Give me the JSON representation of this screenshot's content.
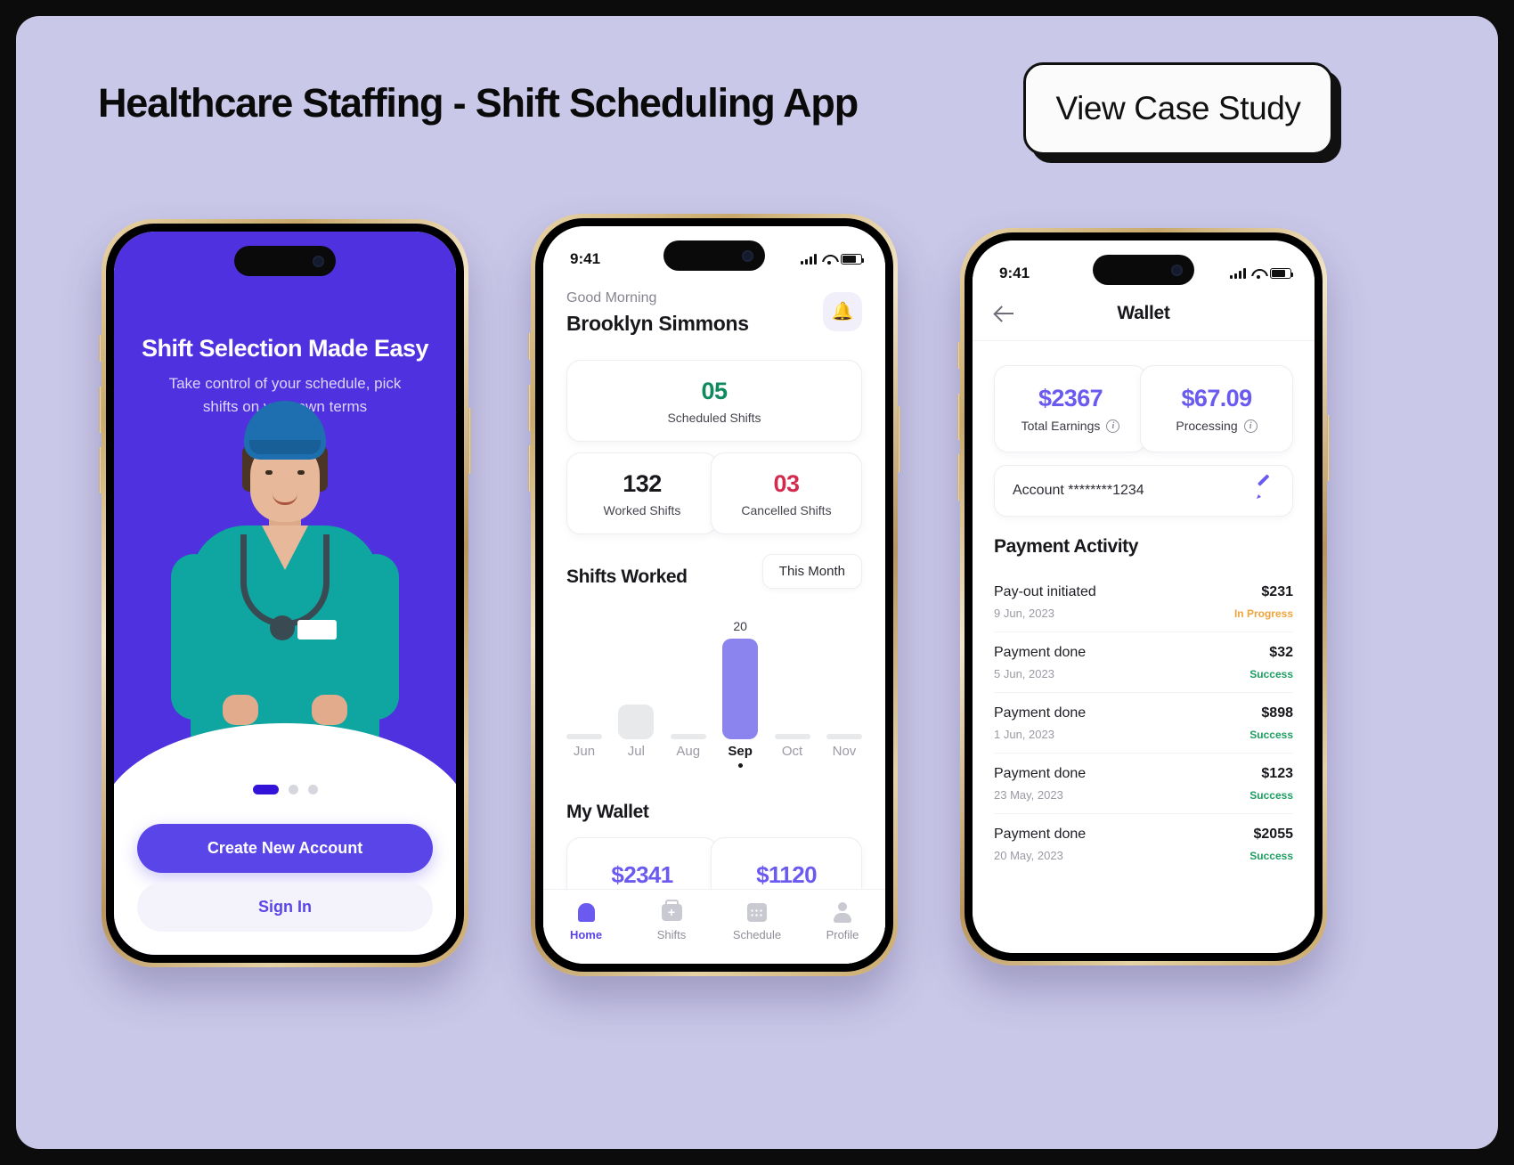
{
  "header": {
    "title": "Healthcare Staffing - Shift Scheduling App",
    "cta_label": "View Case Study"
  },
  "colors": {
    "background": "#cac8e8",
    "brand_purple": "#5a45e8",
    "onboarding_bg": "#4f31e0",
    "accent_light_purple": "#8b84ef",
    "success_green": "#0f8a5f",
    "danger_red": "#d32b4e",
    "warning_orange": "#f0a33c"
  },
  "phone1": {
    "title": "Shift Selection Made Easy",
    "subtitle": "Take control of your schedule, pick shifts on your own terms",
    "pagination": {
      "total": 3,
      "active": 1
    },
    "primary_button": "Create New Account",
    "secondary_button": "Sign In"
  },
  "phone2": {
    "status": {
      "time": "9:41"
    },
    "greeting": "Good Morning",
    "user_name": "Brooklyn Simmons",
    "notification_icon": "bell-icon",
    "stats": [
      {
        "value": "05",
        "label": "Scheduled Shifts",
        "color": "#0f8a5f"
      },
      {
        "value": "132",
        "label": "Worked Shifts",
        "color": "#17171c"
      },
      {
        "value": "03",
        "label": "Cancelled Shifts",
        "color": "#d32b4e"
      }
    ],
    "chart_section_title": "Shifts Worked",
    "period_label": "This Month",
    "wallet_title": "My Wallet",
    "wallet_cards": [
      {
        "amount": "$2341"
      },
      {
        "amount": "$1120"
      }
    ],
    "tabs": [
      {
        "label": "Home",
        "icon": "home-icon",
        "active": true
      },
      {
        "label": "Shifts",
        "icon": "briefcase-plus-icon",
        "active": false
      },
      {
        "label": "Schedule",
        "icon": "calendar-icon",
        "active": false
      },
      {
        "label": "Profile",
        "icon": "user-icon",
        "active": false
      }
    ]
  },
  "chart_data": {
    "type": "bar",
    "title": "Shifts Worked",
    "categories": [
      "Jun",
      "Jul",
      "Aug",
      "Sep",
      "Oct",
      "Nov"
    ],
    "values": [
      1,
      7,
      1,
      20,
      1,
      1
    ],
    "labels": [
      "",
      "",
      "",
      "20",
      "",
      ""
    ],
    "selected_category": "Sep",
    "selected_value": 20,
    "xlabel": "",
    "ylabel": "",
    "ylim": [
      0,
      22
    ],
    "grid": false,
    "legend": false,
    "period": "This Month"
  },
  "phone3": {
    "status": {
      "time": "9:41"
    },
    "back_icon": "back-arrow-icon",
    "title": "Wallet",
    "earnings": [
      {
        "amount": "$2367",
        "label": "Total Earnings",
        "info_icon": "info-icon"
      },
      {
        "amount": "$67.09",
        "label": "Processing",
        "info_icon": "info-icon"
      }
    ],
    "account_label": "Account ********1234",
    "edit_icon": "pencil-icon",
    "activity_title": "Payment Activity",
    "activity": [
      {
        "title": "Pay-out initiated",
        "date": "9 Jun, 2023",
        "amount": "$231",
        "status": "In Progress",
        "status_color": "#f0a33c"
      },
      {
        "title": "Payment done",
        "date": "5 Jun, 2023",
        "amount": "$32",
        "status": "Success",
        "status_color": "#1f9d62"
      },
      {
        "title": "Payment done",
        "date": "1 Jun, 2023",
        "amount": "$898",
        "status": "Success",
        "status_color": "#1f9d62"
      },
      {
        "title": "Payment done",
        "date": "23 May, 2023",
        "amount": "$123",
        "status": "Success",
        "status_color": "#1f9d62"
      },
      {
        "title": "Payment done",
        "date": "20 May, 2023",
        "amount": "$2055",
        "status": "Success",
        "status_color": "#1f9d62"
      }
    ]
  }
}
